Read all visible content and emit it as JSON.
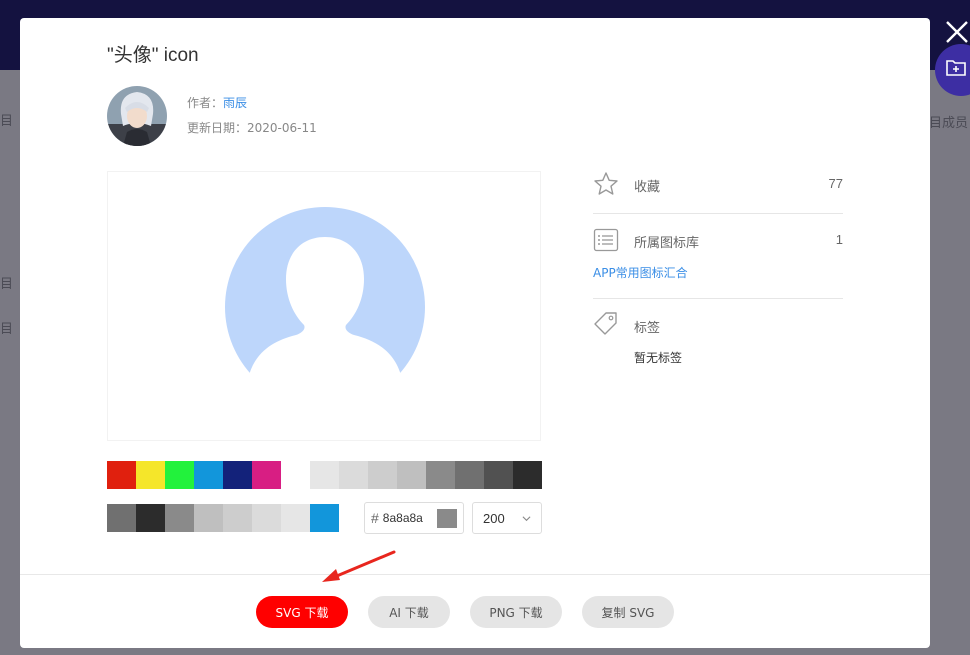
{
  "background": {
    "fragments": [
      "目",
      "目",
      "目",
      "目成员"
    ]
  },
  "modal": {
    "title": "\"头像\" icon",
    "author_label": "作者：",
    "author_name": "雨辰",
    "date_label": "更新日期：",
    "date_value": "2020-06-11"
  },
  "colors": {
    "row1": [
      "#e0200e",
      "#f5e62a",
      "#22f23c",
      "#1296db",
      "#13227a",
      "#d81e83",
      "#ffffff",
      "#e6e6e6",
      "#dbdbdb",
      "#cdcdcd",
      "#bfbfbf",
      "#8a8a8a",
      "#707070",
      "#515151",
      "#2c2c2c"
    ],
    "row2": [
      "#707070",
      "#2c2c2c",
      "#8a8a8a",
      "#bfbfbf",
      "#cdcdcd",
      "#dbdbdb",
      "#e6e6e6",
      "#1296db"
    ],
    "current_hex": "8a8a8a",
    "hash": "#",
    "icon_fill": "#bdd6fb"
  },
  "size": {
    "value": "200"
  },
  "sidebar": {
    "favorites_label": "收藏",
    "favorites_count": "77",
    "library_label": "所属图标库",
    "library_count": "1",
    "library_link": "APP常用图标汇合",
    "tags_label": "标签",
    "tags_empty": "暂无标签"
  },
  "buttons": {
    "svg_download": "SVG 下载",
    "ai_download": "AI 下载",
    "png_download": "PNG 下载",
    "copy_svg": "复制 SVG"
  },
  "icons": [
    "close-icon",
    "folder-add-icon",
    "star-icon",
    "list-icon",
    "tag-icon",
    "chevron-down-icon",
    "arrow-annotation"
  ]
}
